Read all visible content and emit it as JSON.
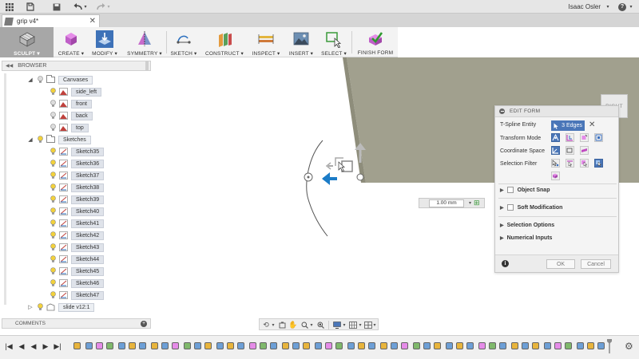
{
  "app": {
    "document_tab": "grip v4*",
    "user_name": "Isaac Osler"
  },
  "toolbar": {
    "tools": [
      {
        "label": "SCULPT ▾",
        "icon": "sculpt-icon",
        "active": true
      },
      {
        "label": "CREATE ▾",
        "icon": "create-box-icon"
      },
      {
        "label": "MODIFY ▾",
        "icon": "modify-icon"
      },
      {
        "label": "SYMMETRY ▾",
        "icon": "symmetry-icon"
      },
      {
        "label": "SKETCH ▾",
        "icon": "sketch-icon"
      },
      {
        "label": "CONSTRUCT ▾",
        "icon": "construct-icon"
      },
      {
        "label": "INSPECT ▾",
        "icon": "inspect-icon"
      },
      {
        "label": "INSERT ▾",
        "icon": "insert-image-icon"
      },
      {
        "label": "SELECT ▾",
        "icon": "select-icon"
      },
      {
        "label": "FINISH FORM",
        "icon": "finish-form-icon"
      }
    ]
  },
  "viewcube": {
    "face": "RIGHT"
  },
  "browser": {
    "title": "BROWSER",
    "canvases_folder": "Canvases",
    "canvases": [
      "side_left",
      "front",
      "back",
      "top"
    ],
    "sketches_folder": "Sketches",
    "sketches": [
      "Sketch35",
      "Sketch36",
      "Sketch37",
      "Sketch38",
      "Sketch39",
      "Sketch40",
      "Sketch41",
      "Sketch42",
      "Sketch43",
      "Sketch44",
      "Sketch45",
      "Sketch46",
      "Sketch47"
    ],
    "body": "slide v12:1"
  },
  "comments": {
    "title": "COMMENTS"
  },
  "edit_form": {
    "title": "EDIT FORM",
    "tspline_entity_label": "T-Spline Entity",
    "selection_chip": "3 Edges",
    "transform_mode_label": "Transform Mode",
    "coordinate_space_label": "Coordinate Space",
    "selection_filter_label": "Selection Filter",
    "object_snap_label": "Object Snap",
    "soft_modification_label": "Soft Modification",
    "selection_options_label": "Selection Options",
    "numerical_inputs_label": "Numerical Inputs",
    "ok_label": "OK",
    "cancel_label": "Cancel"
  },
  "dimension": {
    "value": "1.00 mm"
  },
  "colors": {
    "accent_blue": "#4a76b8",
    "model_surface": "#a0a08e",
    "model_shadow": "#8f8f7c"
  }
}
